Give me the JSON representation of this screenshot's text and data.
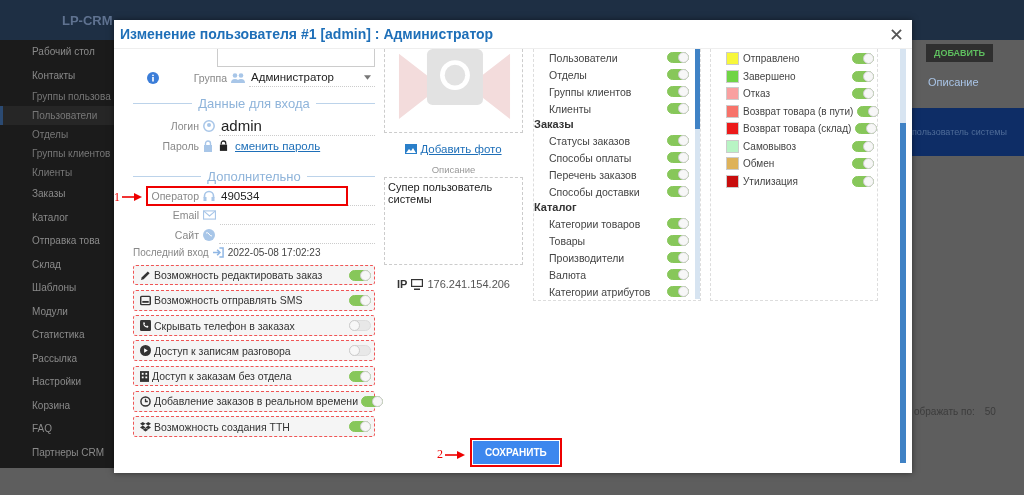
{
  "background": {
    "brand": "LP-CRM",
    "sidebar": [
      {
        "label": "Рабочий стол",
        "sub": false,
        "selected": false
      },
      {
        "label": "Контакты",
        "sub": false,
        "selected": false
      },
      {
        "label": "Группы пользова",
        "sub": true,
        "selected": false
      },
      {
        "label": "Пользователи",
        "sub": true,
        "selected": true
      },
      {
        "label": "Отделы",
        "sub": true,
        "selected": false
      },
      {
        "label": "Группы клиентов",
        "sub": true,
        "selected": false
      },
      {
        "label": "Клиенты",
        "sub": true,
        "selected": false
      },
      {
        "label": "Заказы",
        "sub": false,
        "selected": false
      },
      {
        "label": "Каталог",
        "sub": false,
        "selected": false
      },
      {
        "label": "Отправка това",
        "sub": false,
        "selected": false
      },
      {
        "label": "Склад",
        "sub": false,
        "selected": false
      },
      {
        "label": "Шаблоны",
        "sub": false,
        "selected": false
      },
      {
        "label": "Модули",
        "sub": false,
        "selected": false
      },
      {
        "label": "Статистика",
        "sub": false,
        "selected": false
      },
      {
        "label": "Рассылка",
        "sub": false,
        "selected": false
      },
      {
        "label": "Настройки",
        "sub": false,
        "selected": false
      },
      {
        "label": "Корзина",
        "sub": false,
        "selected": false
      },
      {
        "label": "FAQ",
        "sub": false,
        "selected": false
      },
      {
        "label": "Партнеры CRM",
        "sub": false,
        "selected": false
      }
    ],
    "add_button": "ДОБАВИТЬ",
    "column_header": "Описание",
    "row_text": "пользователь системы",
    "per_page_label": "ображать по:",
    "per_page": "50"
  },
  "dialog": {
    "title": "Изменение пользователя #1 [admin] : Администратор",
    "group": {
      "label": "Группа",
      "value": "Администратор"
    },
    "login_section": "Данные для входа",
    "login": {
      "label": "Логин",
      "value": "admin"
    },
    "password": {
      "label": "Пароль",
      "link": "сменить пароль"
    },
    "extra_section": "Дополнительно",
    "fields": [
      {
        "label": "Оператор",
        "value": "490534",
        "highlighted": true
      },
      {
        "label": "Email",
        "highlighted": false
      },
      {
        "label": "Сайт",
        "highlighted": false
      }
    ],
    "last_login": {
      "label": "Последний вход",
      "value": "2022-05-08 17:02:23"
    },
    "options": [
      {
        "label": "Возможность редактировать заказ",
        "on": true
      },
      {
        "label": "Возможность отправлять SMS",
        "on": true
      },
      {
        "label": "Скрывать телефон в заказах",
        "on": false
      },
      {
        "label": "Доступ к записям разговора",
        "on": false
      },
      {
        "label": "Доступ к заказам без отдела",
        "on": true
      },
      {
        "label": "Добавление заказов в реальном времени",
        "on": true
      },
      {
        "label": "Возможность создания ТТН",
        "on": true
      }
    ],
    "photo": {
      "link": "Добавить фото",
      "description_label": "Описание",
      "description": "Супер пользователь системы",
      "ip_label": "IP",
      "ip": "176.241.154.206"
    },
    "permissions": [
      {
        "kind": "item",
        "label": "Пользователи",
        "on": true
      },
      {
        "kind": "item",
        "label": "Отделы",
        "on": true
      },
      {
        "kind": "item",
        "label": "Группы клиентов",
        "on": true
      },
      {
        "kind": "item",
        "label": "Клиенты",
        "on": true
      },
      {
        "kind": "heading",
        "label": "Заказы"
      },
      {
        "kind": "item",
        "label": "Статусы заказов",
        "on": true
      },
      {
        "kind": "item",
        "label": "Способы оплаты",
        "on": true
      },
      {
        "kind": "item",
        "label": "Перечень заказов",
        "on": true
      },
      {
        "kind": "item",
        "label": "Способы доставки",
        "on": true
      },
      {
        "kind": "heading",
        "label": "Каталог"
      },
      {
        "kind": "item",
        "label": "Категории товаров",
        "on": true
      },
      {
        "kind": "item",
        "label": "Товары",
        "on": true
      },
      {
        "kind": "item",
        "label": "Производители",
        "on": true
      },
      {
        "kind": "item",
        "label": "Валюта",
        "on": true
      },
      {
        "kind": "item",
        "label": "Категории атрибутов",
        "on": true
      }
    ],
    "statuses": [
      {
        "label": "Отправлено",
        "color": "#f7f73a",
        "on": true
      },
      {
        "label": "Завершено",
        "color": "#70d445",
        "on": true
      },
      {
        "label": "Отказ",
        "color": "#f9a0a0",
        "on": true
      },
      {
        "label": "Возврат товара (в пути)",
        "color": "#f7736a",
        "on": true
      },
      {
        "label": "Возврат товара (склад)",
        "color": "#ec1a1a",
        "on": true
      },
      {
        "label": "Самовывоз",
        "color": "#b8f4c4",
        "on": true
      },
      {
        "label": "Обмен",
        "color": "#deb25a",
        "on": true
      },
      {
        "label": "Утилизация",
        "color": "#c80d0d",
        "on": true
      }
    ],
    "save_button": "СОХРАНИТЬ",
    "annotations": [
      {
        "label": "1"
      },
      {
        "label": "2"
      }
    ]
  }
}
